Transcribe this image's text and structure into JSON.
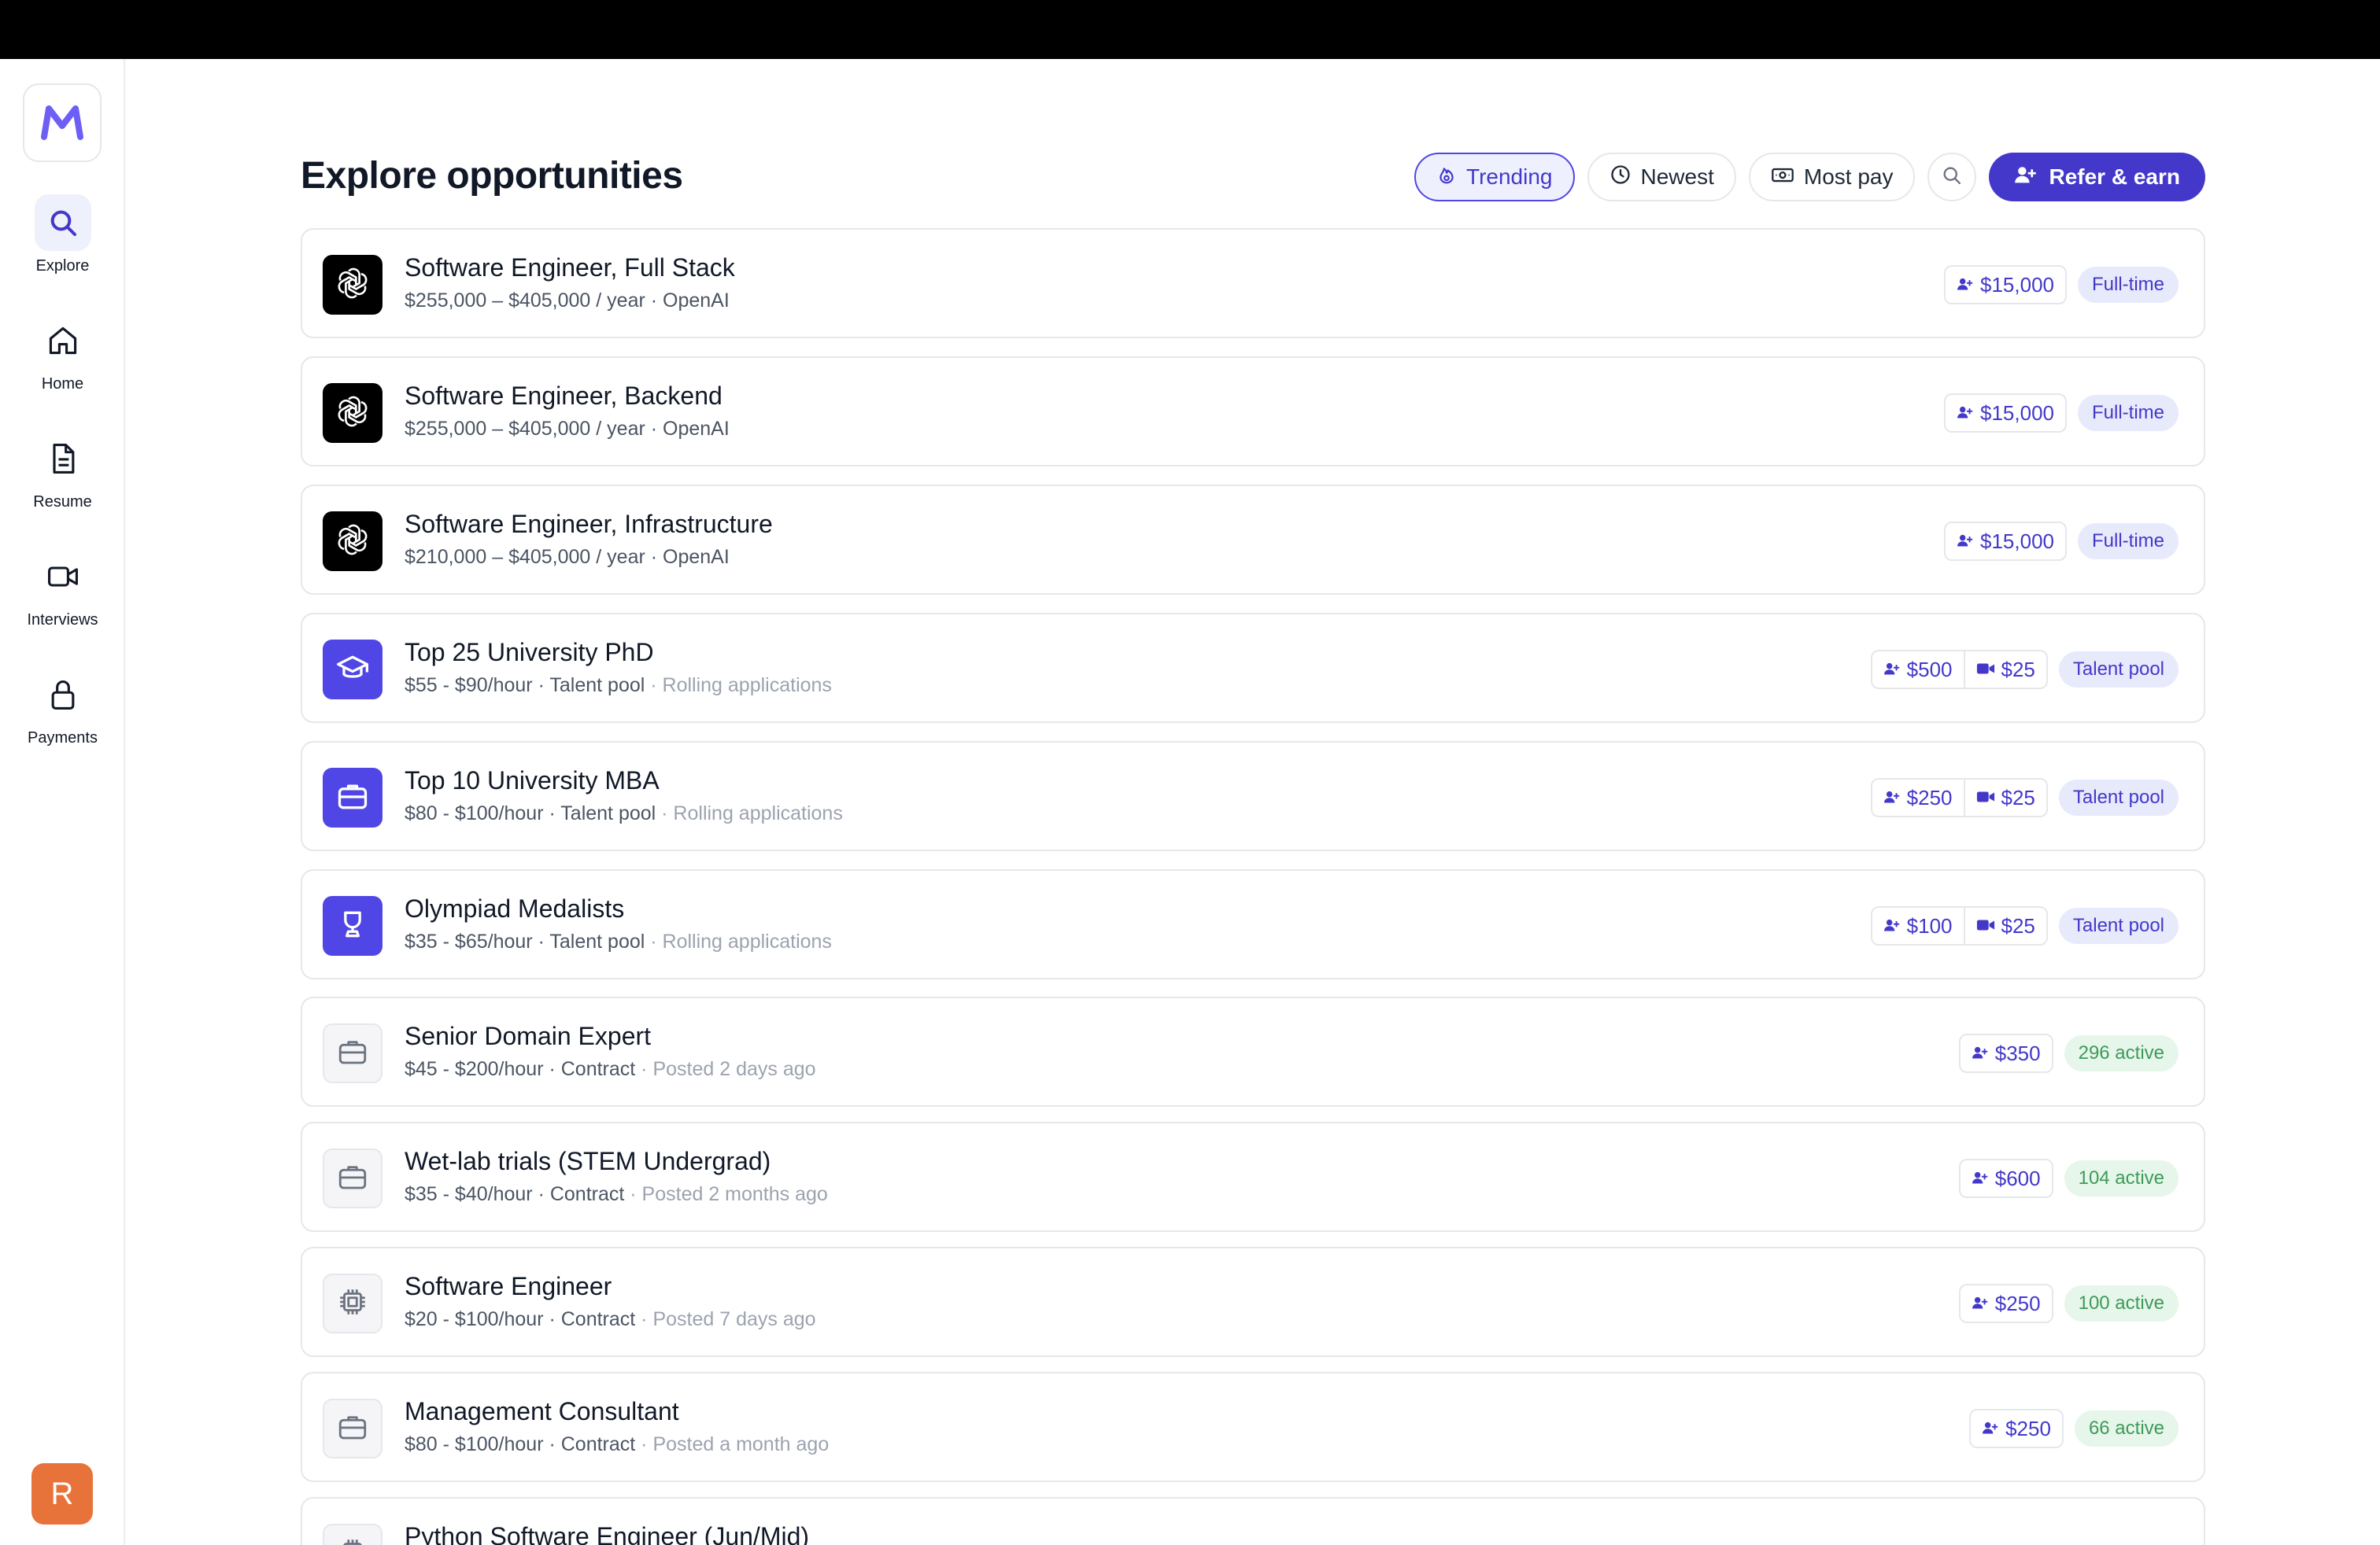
{
  "sidebar": {
    "logo_letter": "M",
    "items": [
      {
        "label": "Explore",
        "icon": "search-icon",
        "active": true
      },
      {
        "label": "Home",
        "icon": "home-icon",
        "active": false
      },
      {
        "label": "Resume",
        "icon": "document-icon",
        "active": false
      },
      {
        "label": "Interviews",
        "icon": "video-icon",
        "active": false
      },
      {
        "label": "Payments",
        "icon": "lock-icon",
        "active": false
      }
    ],
    "avatar_initial": "R"
  },
  "header": {
    "title": "Explore opportunities",
    "filters": [
      {
        "label": "Trending",
        "icon": "flame-icon",
        "active": true
      },
      {
        "label": "Newest",
        "icon": "clock-icon",
        "active": false
      },
      {
        "label": "Most pay",
        "icon": "cash-icon",
        "active": false
      }
    ],
    "refer_label": "Refer & earn"
  },
  "jobs": [
    {
      "title": "Software Engineer, Full Stack",
      "sub": "$255,000 – $405,000 / year · OpenAI",
      "muted": "",
      "logo": "openai",
      "referral": "$15,000",
      "interview": "",
      "tag": "Full-time",
      "tag_color": "blue"
    },
    {
      "title": "Software Engineer, Backend",
      "sub": "$255,000 – $405,000 / year · OpenAI",
      "muted": "",
      "logo": "openai",
      "referral": "$15,000",
      "interview": "",
      "tag": "Full-time",
      "tag_color": "blue"
    },
    {
      "title": "Software Engineer, Infrastructure",
      "sub": "$210,000 – $405,000 / year · OpenAI",
      "muted": "",
      "logo": "openai",
      "referral": "$15,000",
      "interview": "",
      "tag": "Full-time",
      "tag_color": "blue"
    },
    {
      "title": "Top 25 University PhD",
      "sub": "$55 - $90/hour · Talent pool",
      "muted": " · Rolling applications",
      "logo": "graduation",
      "referral": "$500",
      "interview": "$25",
      "tag": "Talent pool",
      "tag_color": "blue"
    },
    {
      "title": "Top 10 University MBA",
      "sub": "$80 - $100/hour · Talent pool",
      "muted": " · Rolling applications",
      "logo": "briefcase-purple",
      "referral": "$250",
      "interview": "$25",
      "tag": "Talent pool",
      "tag_color": "blue"
    },
    {
      "title": "Olympiad Medalists",
      "sub": "$35 - $65/hour · Talent pool",
      "muted": " · Rolling applications",
      "logo": "trophy",
      "referral": "$100",
      "interview": "$25",
      "tag": "Talent pool",
      "tag_color": "blue"
    },
    {
      "title": "Senior Domain Expert",
      "sub": "$45 - $200/hour · Contract",
      "muted": " · Posted 2 days ago",
      "logo": "briefcase",
      "referral": "$350",
      "interview": "",
      "tag": "296 active",
      "tag_color": "green"
    },
    {
      "title": "Wet-lab trials (STEM Undergrad)",
      "sub": "$35 - $40/hour · Contract",
      "muted": " · Posted 2 months ago",
      "logo": "briefcase",
      "referral": "$600",
      "interview": "",
      "tag": "104 active",
      "tag_color": "green"
    },
    {
      "title": "Software Engineer",
      "sub": "$20 - $100/hour · Contract",
      "muted": " · Posted 7 days ago",
      "logo": "chip",
      "referral": "$250",
      "interview": "",
      "tag": "100 active",
      "tag_color": "green"
    },
    {
      "title": "Management Consultant",
      "sub": "$80 - $100/hour · Contract",
      "muted": " · Posted a month ago",
      "logo": "briefcase",
      "referral": "$250",
      "interview": "",
      "tag": "66 active",
      "tag_color": "green"
    },
    {
      "title": "Python Software Engineer (Jun/Mid)",
      "sub": "",
      "muted": "",
      "logo": "chip",
      "referral": "",
      "interview": "",
      "tag": "",
      "tag_color": "green"
    }
  ]
}
